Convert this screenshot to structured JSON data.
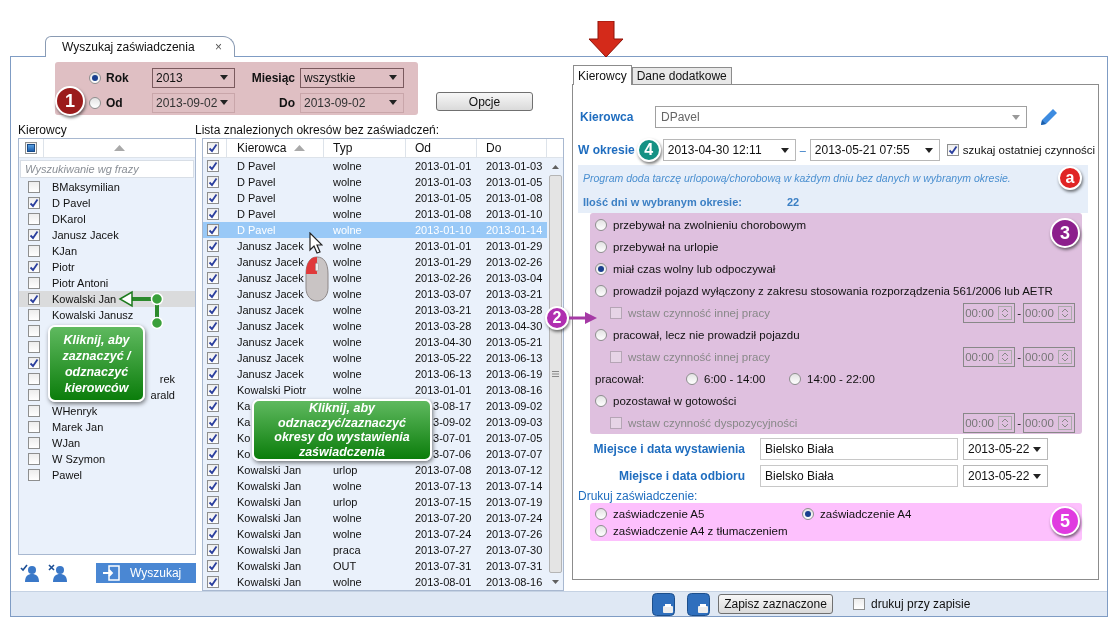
{
  "tab": {
    "title": "Wyszukaj zaświadczenia",
    "close": "×"
  },
  "filter": {
    "modes": [
      {
        "label": "Rok",
        "selected": true,
        "value": "2013",
        "field_label": "Miesiąc",
        "field_value": "wszystkie"
      },
      {
        "label": "Od",
        "selected": false,
        "value": "2013-09-02",
        "field_label": "Do",
        "field_value": "2013-09-02"
      }
    ],
    "options_button": "Opcje"
  },
  "drivers": {
    "title": "Kierowcy",
    "select_all": {
      "mixed": true
    },
    "search_placeholder": "Wyszukiwanie wg frazy",
    "items": [
      {
        "kind": "row",
        "name": "BMaksymilian",
        "checked": false,
        "selected": false
      },
      {
        "kind": "row",
        "name": "D Pavel",
        "checked": true,
        "selected": false
      },
      {
        "kind": "row",
        "name": "DKarol",
        "checked": false,
        "selected": false
      },
      {
        "kind": "row",
        "name": "Janusz Jacek",
        "checked": true,
        "selected": false
      },
      {
        "kind": "row",
        "name": "KJan",
        "checked": false,
        "selected": false
      },
      {
        "kind": "row",
        "name": "Piotr",
        "checked": true,
        "selected": false
      },
      {
        "kind": "row",
        "name": "Piotr Antoni",
        "checked": false,
        "selected": false
      },
      {
        "kind": "row",
        "name": "Kowalski Jan",
        "checked": true,
        "selected": true
      },
      {
        "kind": "row",
        "name": "Kowalski Janusz",
        "checked": false,
        "selected": false
      },
      {
        "checked": false,
        "selected": false
      },
      {
        "checked": false,
        "selected": false
      },
      {
        "checked": true,
        "selected": false
      },
      {
        "kind": "covered",
        "name": "rek",
        "checked": false,
        "selected": false
      },
      {
        "kind": "covered",
        "name": "arald",
        "checked": false,
        "selected": false
      },
      {
        "kind": "row",
        "name": "WHenryk",
        "checked": false,
        "selected": false
      },
      {
        "kind": "row",
        "name": "Marek Jan",
        "checked": false,
        "selected": false
      },
      {
        "kind": "row",
        "name": "WJan",
        "checked": false,
        "selected": false
      },
      {
        "kind": "row",
        "name": "W Szymon",
        "checked": false,
        "selected": false
      },
      {
        "kind": "row",
        "name": "Pawel",
        "checked": false,
        "selected": false
      }
    ],
    "search_button": "Wyszukaj"
  },
  "periods": {
    "title": "Lista znalezionych okresów bez zaświadczeń:",
    "select_all": {
      "checked": true
    },
    "columns": [
      "Kierowca",
      "Typ",
      "Od",
      "Do"
    ],
    "rows": [
      {
        "kind": "row",
        "checked": true,
        "selected": false,
        "driver": "D Pavel",
        "type": "wolne",
        "from": "2013-01-01",
        "to": "2013-01-03"
      },
      {
        "kind": "row",
        "checked": true,
        "selected": false,
        "driver": "D Pavel",
        "type": "wolne",
        "from": "2013-01-03",
        "to": "2013-01-05"
      },
      {
        "kind": "row",
        "checked": true,
        "selected": false,
        "driver": "D Pavel",
        "type": "wolne",
        "from": "2013-01-05",
        "to": "2013-01-08"
      },
      {
        "kind": "row",
        "checked": true,
        "selected": false,
        "driver": "D Pavel",
        "type": "wolne",
        "from": "2013-01-08",
        "to": "2013-01-10"
      },
      {
        "kind": "row",
        "checked": true,
        "selected": true,
        "driver": "D Pavel",
        "type": "wolne",
        "from": "2013-01-10",
        "to": "2013-01-14"
      },
      {
        "kind": "row",
        "checked": true,
        "selected": false,
        "driver": "Janusz Jacek",
        "type": "wolne",
        "from": "2013-01-01",
        "to": "2013-01-29"
      },
      {
        "kind": "row",
        "checked": true,
        "selected": false,
        "driver": "Janusz Jacek",
        "type": "wolne",
        "from": "2013-01-29",
        "to": "2013-02-26"
      },
      {
        "kind": "row",
        "checked": true,
        "selected": false,
        "driver": "Janusz Jacek",
        "type": "wolne",
        "from": "2013-02-26",
        "to": "2013-03-04"
      },
      {
        "kind": "row",
        "checked": true,
        "selected": false,
        "driver": "Janusz Jacek",
        "type": "wolne",
        "from": "2013-03-07",
        "to": "2013-03-21"
      },
      {
        "kind": "row",
        "checked": true,
        "selected": false,
        "driver": "Janusz Jacek",
        "type": "wolne",
        "from": "2013-03-21",
        "to": "2013-03-28"
      },
      {
        "kind": "row",
        "checked": true,
        "selected": false,
        "driver": "Janusz Jacek",
        "type": "wolne",
        "from": "2013-03-28",
        "to": "2013-04-30"
      },
      {
        "kind": "row",
        "checked": true,
        "selected": false,
        "driver": "Janusz Jacek",
        "type": "wolne",
        "from": "2013-04-30",
        "to": "2013-05-21"
      },
      {
        "kind": "row",
        "checked": true,
        "selected": false,
        "driver": "Janusz Jacek",
        "type": "wolne",
        "from": "2013-05-22",
        "to": "2013-06-13"
      },
      {
        "kind": "row",
        "checked": true,
        "selected": false,
        "driver": "Janusz Jacek",
        "type": "wolne",
        "from": "2013-06-13",
        "to": "2013-06-19"
      },
      {
        "kind": "row",
        "checked": true,
        "selected": false,
        "driver": "Kowalski Piotr",
        "type": "wolne",
        "from": "2013-01-01",
        "to": "2013-08-16"
      },
      {
        "kind": "covered",
        "checked": true,
        "selected": false,
        "driver": "Ka",
        "from": "3-08-17",
        "to": "2013-09-02"
      },
      {
        "kind": "covered",
        "checked": true,
        "selected": false,
        "driver": "Ka",
        "from": "3-09-02",
        "to": "2013-09-03"
      },
      {
        "kind": "covered",
        "checked": true,
        "selected": false,
        "driver": "Ko",
        "from": "3-07-01",
        "to": "2013-07-05"
      },
      {
        "kind": "covered",
        "checked": true,
        "selected": false,
        "driver": "Ko",
        "from": "3-07-06",
        "to": "2013-07-07"
      },
      {
        "kind": "row",
        "checked": true,
        "selected": false,
        "driver": "Kowalski Jan",
        "type": "urlop",
        "from": "2013-07-08",
        "to": "2013-07-12"
      },
      {
        "kind": "row",
        "checked": true,
        "selected": false,
        "driver": "Kowalski Jan",
        "type": "wolne",
        "from": "2013-07-13",
        "to": "2013-07-14"
      },
      {
        "kind": "row",
        "checked": true,
        "selected": false,
        "driver": "Kowalski Jan",
        "type": "urlop",
        "from": "2013-07-15",
        "to": "2013-07-19"
      },
      {
        "kind": "row",
        "checked": true,
        "selected": false,
        "driver": "Kowalski Jan",
        "type": "wolne",
        "from": "2013-07-20",
        "to": "2013-07-24"
      },
      {
        "kind": "row",
        "checked": true,
        "selected": false,
        "driver": "Kowalski Jan",
        "type": "wolne",
        "from": "2013-07-24",
        "to": "2013-07-26"
      },
      {
        "kind": "row",
        "checked": true,
        "selected": false,
        "driver": "Kowalski Jan",
        "type": "praca",
        "from": "2013-07-27",
        "to": "2013-07-30"
      },
      {
        "kind": "row",
        "checked": true,
        "selected": false,
        "driver": "Kowalski Jan",
        "type": "OUT",
        "from": "2013-07-31",
        "to": "2013-07-31"
      },
      {
        "kind": "row",
        "checked": true,
        "selected": false,
        "driver": "Kowalski Jan",
        "type": "wolne",
        "from": "2013-08-01",
        "to": "2013-08-16"
      }
    ]
  },
  "details": {
    "tabs": [
      {
        "label": "Kierowcy",
        "selected": true
      },
      {
        "label": "Dane dodatkowe",
        "selected": false
      }
    ],
    "driver_label": "Kierowca",
    "driver_value": "DPavel",
    "period_label": "W okresie",
    "period_from": "2013-04-30 12:11",
    "period_separator": "–",
    "period_to": "2013-05-21 07:55",
    "last_activity": {
      "label": "szukaj ostatniej czynności",
      "checked": true
    },
    "info": "Program doda tarczę urlopową/chorobową w każdym dniu bez danych w wybranym okresie.",
    "days_label": "Ilość dni w wybranym okresie:",
    "days_value": "22",
    "activities": [
      {
        "kind": "radio",
        "label": "przebywał na zwolnieniu chorobowym",
        "selected": false
      },
      {
        "kind": "radio",
        "label": "przebywał na urlopie",
        "selected": false
      },
      {
        "kind": "radio",
        "label": "miał czas wolny lub odpoczywał",
        "selected": true
      },
      {
        "kind": "radio",
        "label": "prowadził pojazd wyłączony z zakresu stosowania rozporządzenia 561/2006 lub AETR",
        "selected": false
      },
      {
        "kind": "check",
        "label": "wstaw czynność innej pracy",
        "checked": false,
        "disabled": true,
        "from": "00:00",
        "separator": "-",
        "to": "00:00"
      },
      {
        "kind": "radio",
        "label": "pracował, lecz nie prowadził pojazdu",
        "selected": false
      },
      {
        "kind": "check",
        "label": "wstaw czynność innej pracy",
        "checked": false,
        "disabled": true,
        "from": "00:00",
        "separator": "-",
        "to": "00:00"
      },
      {
        "kind": "shift",
        "label": "pracował:",
        "options": [
          {
            "label": "6:00 - 14:00",
            "selected": false
          },
          {
            "label": "14:00 - 22:00",
            "selected": false
          }
        ]
      },
      {
        "kind": "radio",
        "label": "pozostawał w gotowości",
        "selected": false
      },
      {
        "kind": "check",
        "label": "wstaw czynność dyspozycyjności",
        "checked": false,
        "disabled": true,
        "from": "00:00",
        "separator": "-",
        "to": "00:00"
      }
    ],
    "places": [
      {
        "label": "Miejsce i data wystawienia",
        "place": "Bielsko Biała",
        "date": "2013-05-22"
      },
      {
        "label": "Miejsce i data odbioru",
        "place": "Bielsko Biała",
        "date": "2013-05-22"
      }
    ],
    "print_label": "Drukuj zaświadczenie:",
    "print_options": [
      {
        "label": "zaświadczenie A5",
        "selected": false
      },
      {
        "label": "zaświadczenie A4",
        "selected": true
      },
      {
        "label": "zaświadczenie A4 z tłumaczeniem",
        "selected": false
      }
    ]
  },
  "footer": {
    "save_button": "Zapisz zaznaczone",
    "print_on_save": {
      "label": "drukuj przy zapisie",
      "checked": false
    }
  },
  "badges": [
    {
      "label": "1",
      "color": "#9b1b1b"
    },
    {
      "label": "2",
      "color": "#b02eb0"
    },
    {
      "label": "3",
      "color": "#8c1f8c"
    },
    {
      "label": "4",
      "color": "#159184"
    },
    {
      "label": "5",
      "color": "#e03be0"
    },
    {
      "label": "a",
      "color": "#e02424"
    }
  ],
  "callouts": [
    "Kliknij, aby zaznaczyć / odznaczyć kierowców",
    "Kliknij, aby odznaczyć/zaznaczyć okresy do wystawienia zaświadczenia"
  ]
}
